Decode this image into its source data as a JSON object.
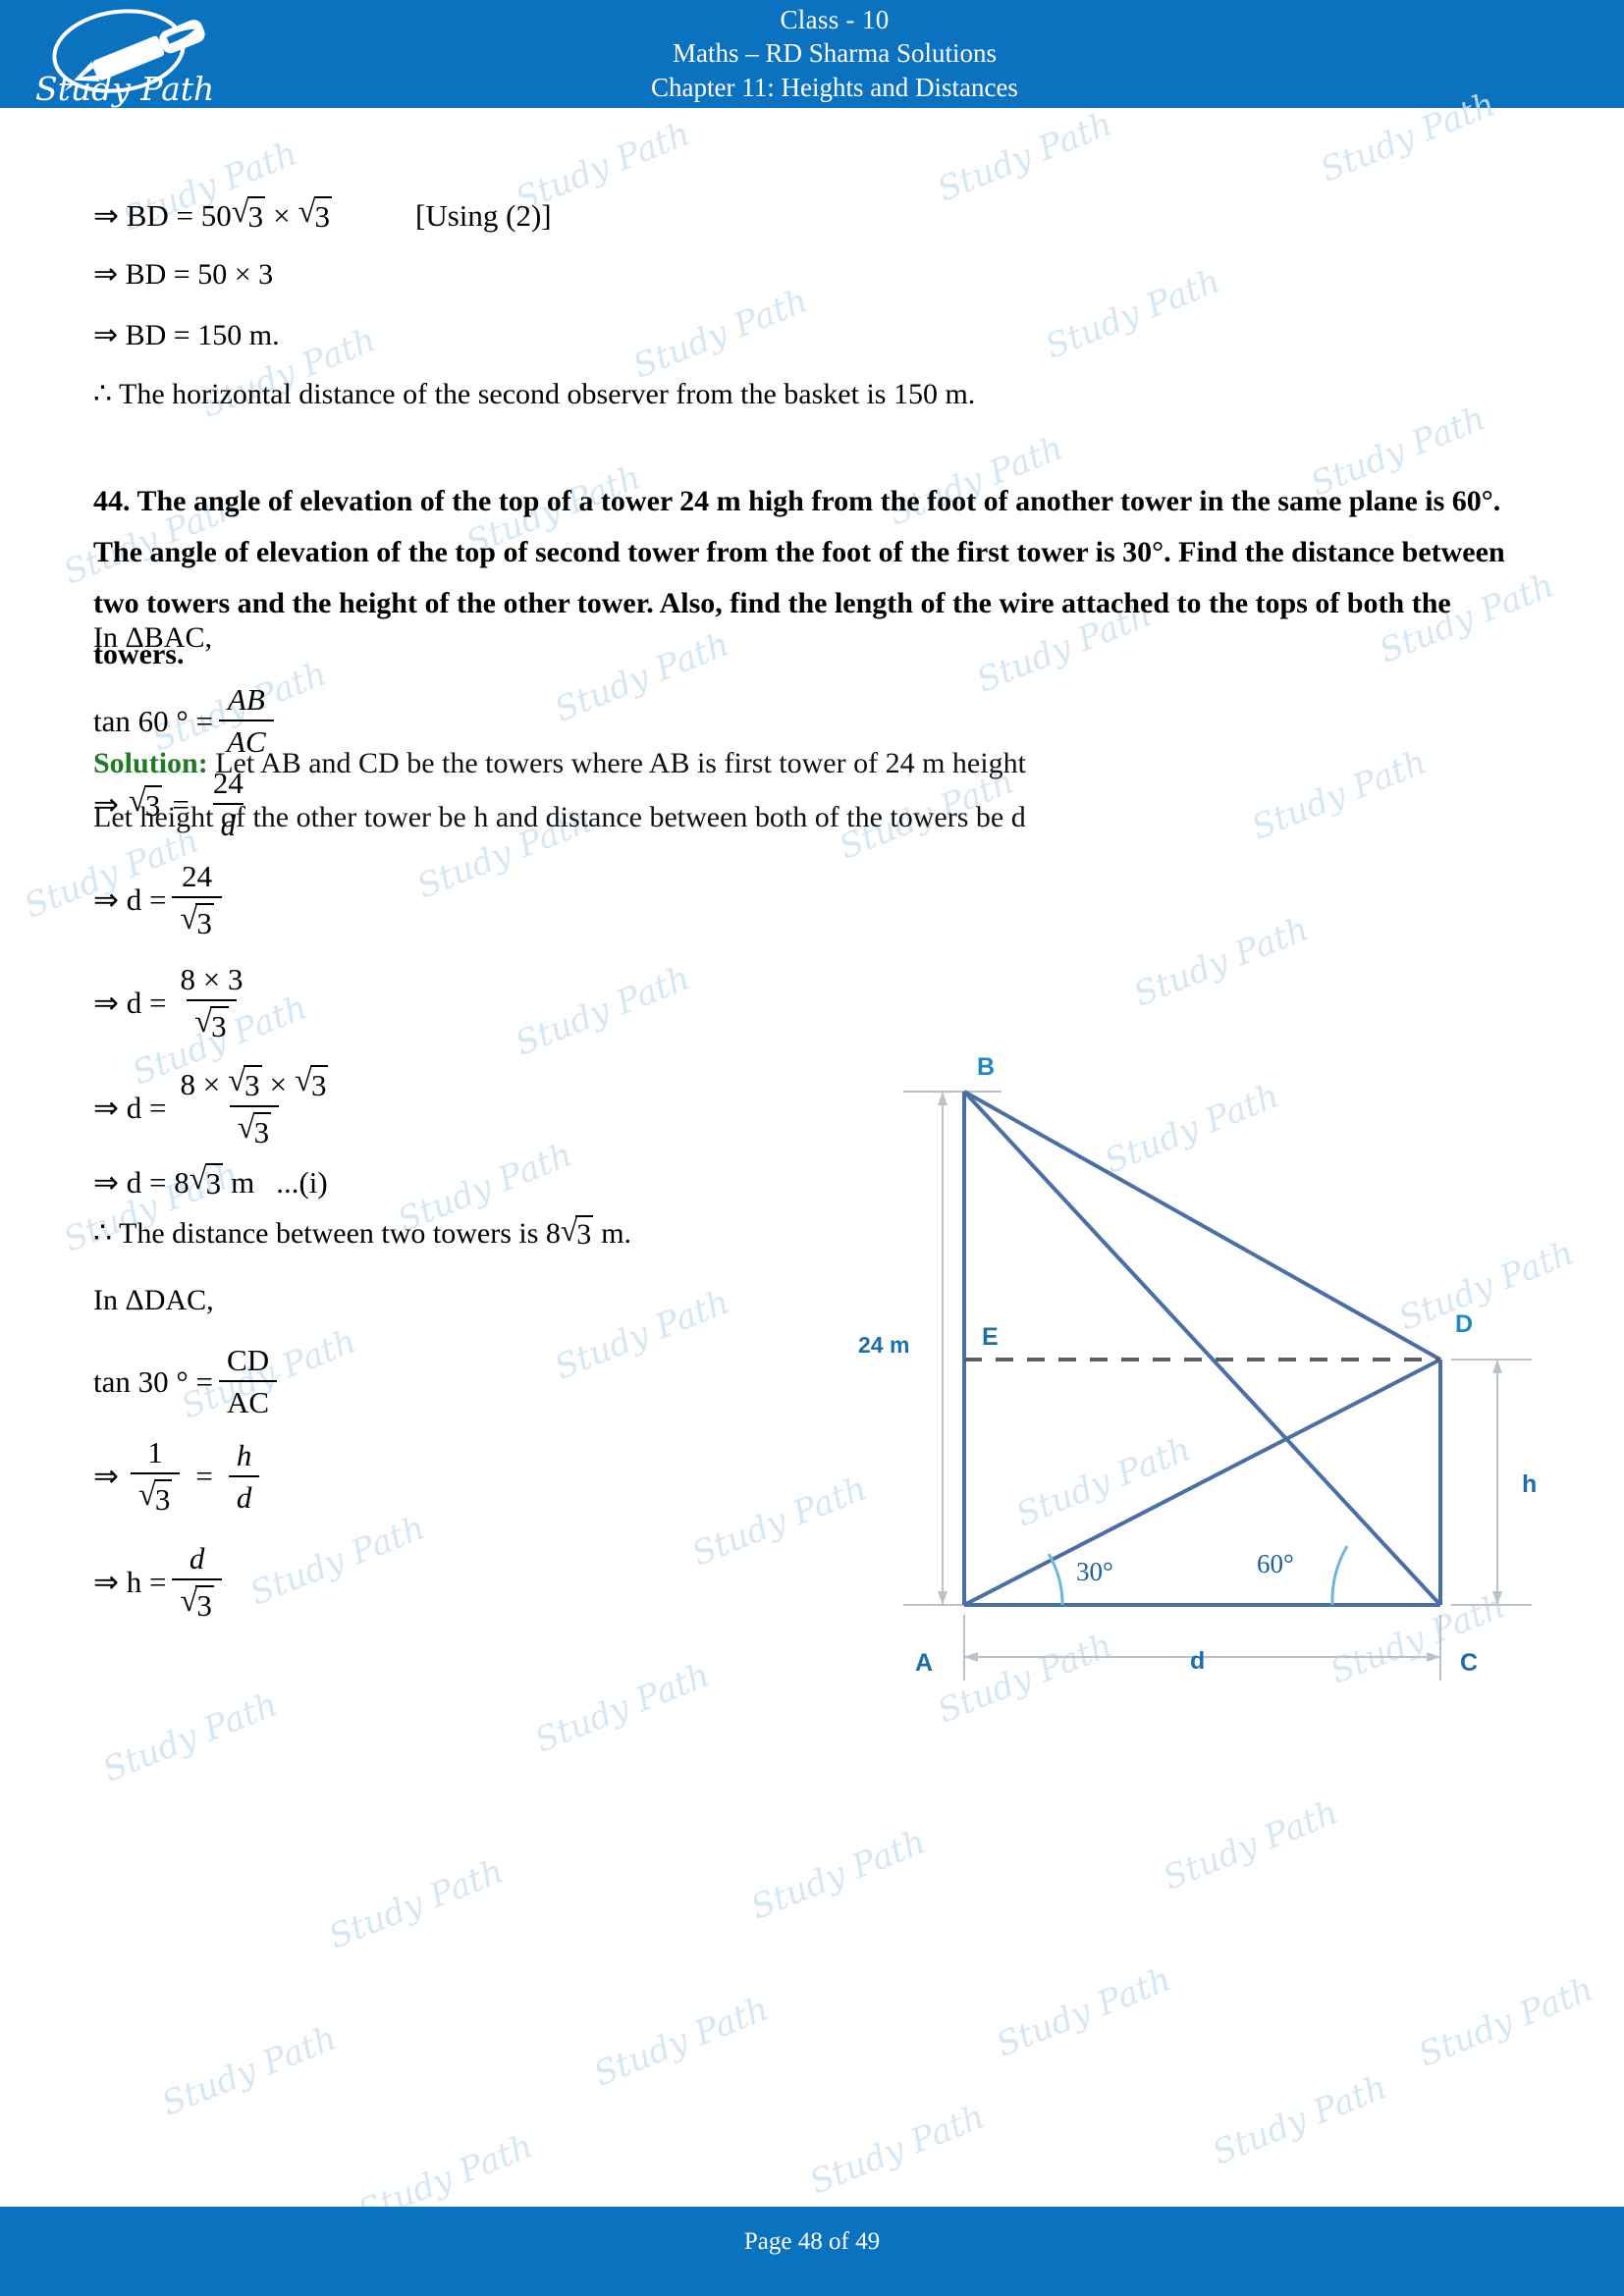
{
  "header": {
    "logo_alt": "Study Path",
    "logo_text": "Study Path",
    "line1": "Class - 10",
    "line2": "Maths – RD Sharma Solutions",
    "line3": "Chapter 11: Heights and Distances",
    "bg_color": "#0b72bf"
  },
  "footer": {
    "page_text": "Page 48 of 49",
    "bg_color": "#0b72bf"
  },
  "watermark": {
    "text": "Study Path"
  },
  "top_steps": {
    "line1_prefix": "⇒ BD = 50",
    "line1_root": "3",
    "line1_mid": "×",
    "line1_root2": "3",
    "line1_note": "[Using (2)]",
    "line2": "⇒ BD = 50 × 3",
    "line3": "⇒ BD = 150 m.",
    "line4": "∴ The horizontal distance of the second observer from the basket is 150 m."
  },
  "question": {
    "number": "44.",
    "text": "The angle of elevation of the top of a tower 24 m high from the foot of another tower in the same plane is 60°. The angle of elevation of the top of second tower from the foot of the first tower is 30°. Find the distance between two towers and the height of the other tower. Also, find the length of the wire attached to the tops of both the towers."
  },
  "solution": {
    "label": "Solution:",
    "line1": " Let AB and CD be the towers where AB is first tower of 24 m height",
    "line2": "Let height of the other tower be h and distance between both of the towers be d"
  },
  "work": {
    "tri1_heading": "In ΔBAC,",
    "eq1_left": "tan 60 ° =",
    "eq1_num": "AB",
    "eq1_den": "AC",
    "eq2_left": "⇒",
    "eq2_root": "3",
    "eq2_eq": "=",
    "eq2_num": "24",
    "eq2_den": "d",
    "eq3_left": "⇒ d =",
    "eq3_num": "24",
    "eq3_den_root": "3",
    "eq4_left": "⇒ d =",
    "eq4_num": "8 × ",
    "eq4_num_b": "3",
    "eq4_den_root": "3",
    "eq5_left": "⇒ d =",
    "eq5_num_a": "8 ×",
    "eq5_num_r1": "3",
    "eq5_num_x": "×",
    "eq5_num_r2": "3",
    "eq5_den_root": "3",
    "eq6_left": "⇒ d = 8",
    "eq6_root": "3",
    "eq6_unit": "m",
    "eq6_tag": "...(i)",
    "concl1_a": "∴ The distance between two towers is 8",
    "concl1_root": "3",
    "concl1_b": "m.",
    "tri2_heading": "In ΔDAC,",
    "eq7_left": "tan 30 ° =",
    "eq7_num": "CD",
    "eq7_den": "AC",
    "eq8_left": "⇒",
    "eq8_num1": "1",
    "eq8_den1_root": "3",
    "eq8_eq": "=",
    "eq8_num2": "h",
    "eq8_den2": "d",
    "eq9_left": "⇒ h =",
    "eq9_num": "d",
    "eq9_den_root": "3"
  },
  "diagram": {
    "label_B": "B",
    "label_A": "A",
    "label_C": "C",
    "label_D": "D",
    "label_E": "E",
    "label_h": "h",
    "label_d": "d",
    "label_height": "24 m",
    "angle_left": "30°",
    "angle_right": "60°",
    "line_color": "#4a6fa5",
    "label_color": "#1f6fa8",
    "dim_color": "#9aa5ad"
  }
}
